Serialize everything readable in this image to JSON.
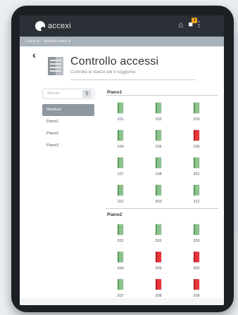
{
  "app": {
    "logo_text": "accexi",
    "notification_count": "1"
  },
  "breadcrumb": [
    "Check in",
    "Modifica check in"
  ],
  "page": {
    "title": "Controllo accessi",
    "subtitle": "Controlla le stanze per il soggiorno"
  },
  "search": {
    "placeholder": "Stanza"
  },
  "sidebar": {
    "items": [
      {
        "label": "Strutture",
        "active": true
      },
      {
        "label": "Piano1",
        "active": false
      },
      {
        "label": "Piano2",
        "active": false
      },
      {
        "label": "Piano3",
        "active": false
      }
    ]
  },
  "status_colors": {
    "free": "#8cc38d",
    "occupied": "#e8353a"
  },
  "floors": [
    {
      "name": "Piano1",
      "rooms": [
        {
          "number": "101",
          "status": "free"
        },
        {
          "number": "102",
          "status": "free"
        },
        {
          "number": "103",
          "status": "free"
        },
        {
          "number": "104",
          "status": "free"
        },
        {
          "number": "105",
          "status": "free"
        },
        {
          "number": "106",
          "status": "occupied"
        },
        {
          "number": "107",
          "status": "free"
        },
        {
          "number": "108",
          "status": "free"
        },
        {
          "number": "301",
          "status": "free"
        },
        {
          "number": "110",
          "status": "free"
        },
        {
          "number": "303",
          "status": "free"
        },
        {
          "number": "112",
          "status": "free"
        }
      ]
    },
    {
      "name": "Piano2",
      "rooms": [
        {
          "number": "201",
          "status": "free"
        },
        {
          "number": "202",
          "status": "free"
        },
        {
          "number": "203",
          "status": "free"
        },
        {
          "number": "204",
          "status": "free"
        },
        {
          "number": "205",
          "status": "occupied"
        },
        {
          "number": "302",
          "status": "occupied"
        },
        {
          "number": "207",
          "status": "free"
        },
        {
          "number": "208",
          "status": "occupied"
        },
        {
          "number": "209",
          "status": "occupied"
        }
      ]
    }
  ]
}
